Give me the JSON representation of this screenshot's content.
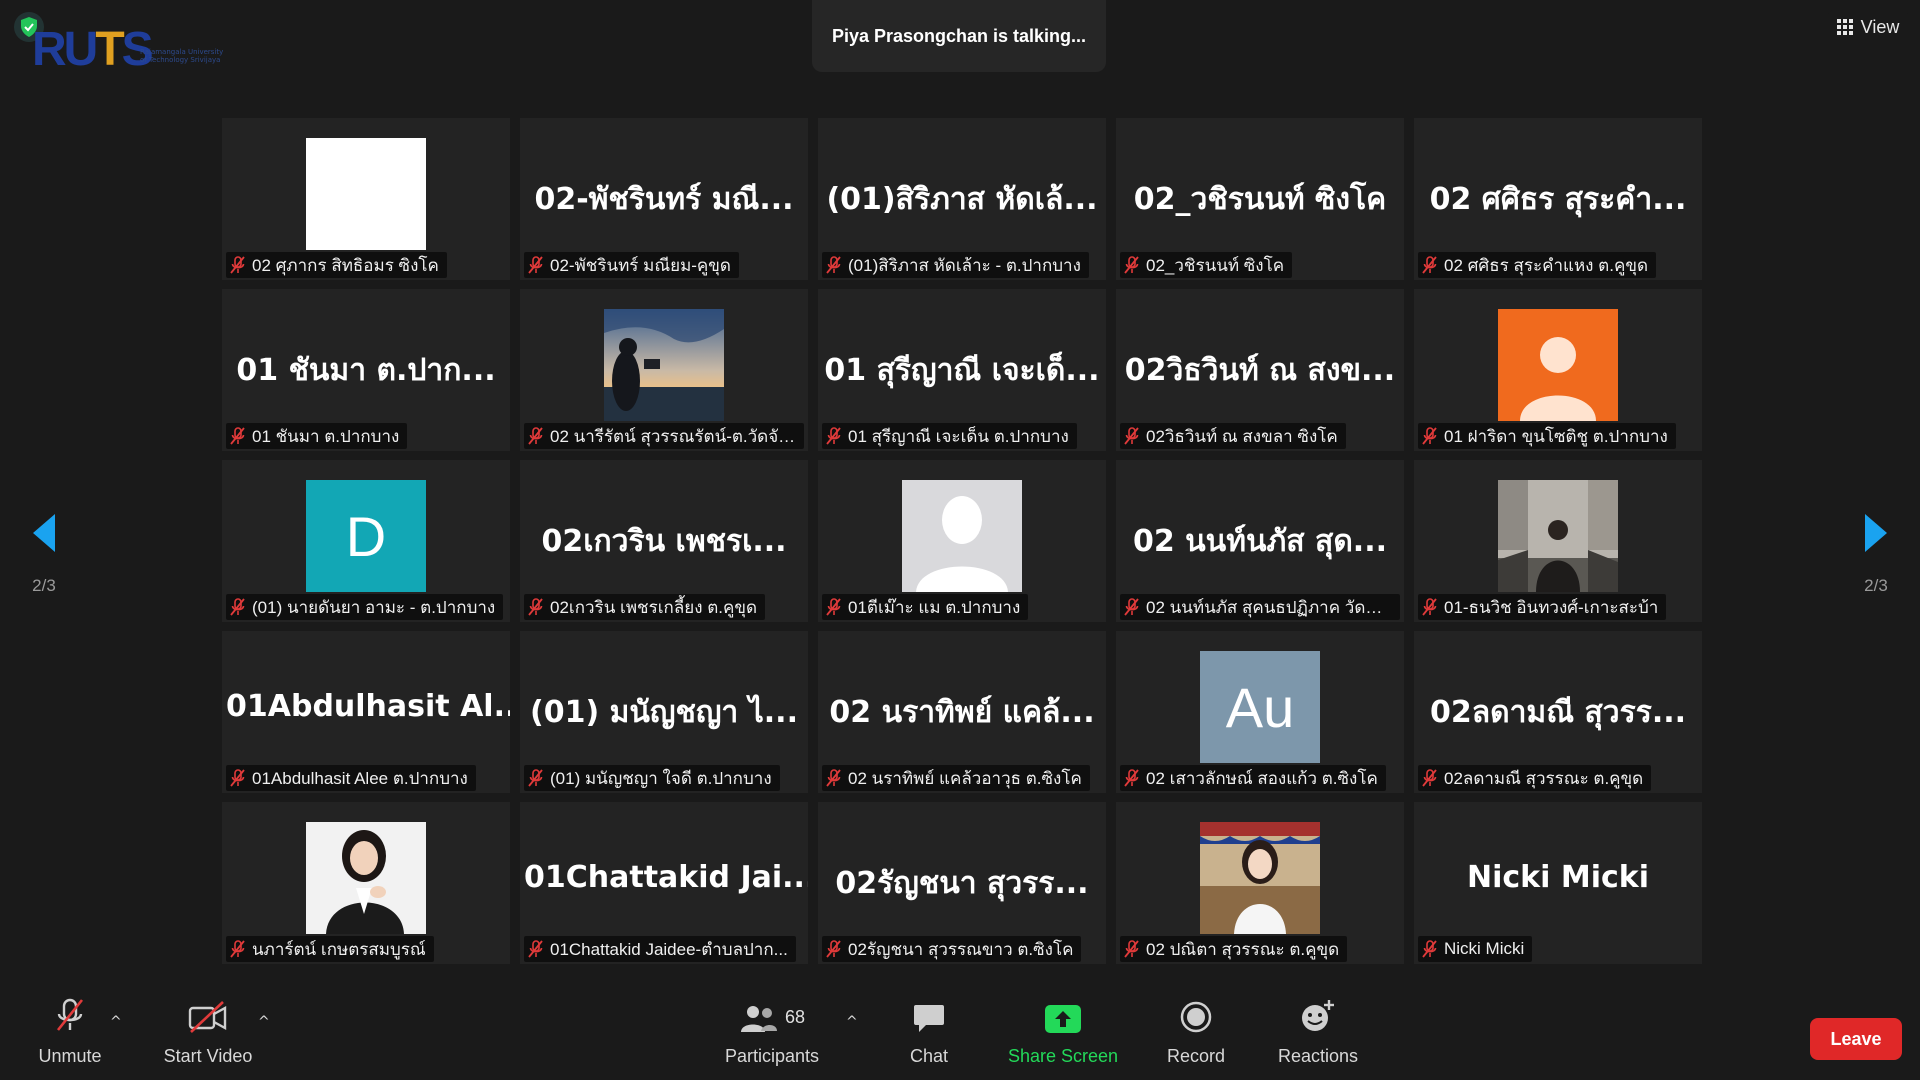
{
  "logo": {
    "text": "RUTS",
    "subtitle": "Rajamangala University of Technology Srivijaya"
  },
  "talking": "Piya Prasongchan is talking...",
  "view": {
    "label": "View"
  },
  "pager": {
    "left": "2/3",
    "right": "2/3"
  },
  "tiles": [
    {
      "big": "",
      "avatar": "white",
      "name": "02 ศุภากร สิทธิอมร ซิงโค"
    },
    {
      "big": "02-พัชรินทร์ มณี...",
      "avatar": "",
      "name": "02-พัชรินทร์ มณียม-คูขุด"
    },
    {
      "big": "(01)สิริภาส หัดเล้...",
      "avatar": "",
      "name": "(01)สิริภาส หัดเล้าะ - ต.ปากบาง"
    },
    {
      "big": "02_วชิรนนท์ ซิงโค",
      "avatar": "",
      "name": "02_วชิรนนท์ ซิงโค"
    },
    {
      "big": "02 ศศิธร สุระคำ...",
      "avatar": "",
      "name": "02 ศศิธร สุระคำแหง ต.คูขุด"
    },
    {
      "big": "01 ชันมา ต.ปาก...",
      "avatar": "",
      "name": "01 ชันมา ต.ปากบาง"
    },
    {
      "big": "",
      "avatar": "sunset",
      "name": "02 นารีรัตน์ สุวรรณรัตน์-ต.วัดจัน..."
    },
    {
      "big": "01 สุรีญาณี เจะเด็...",
      "avatar": "",
      "name": "01 สุรีญาณี เจะเด็น ต.ปากบาง"
    },
    {
      "big": "02วิธวินท์ ณ สงข...",
      "avatar": "",
      "name": "02วิธวินท์ ณ สงขลา ซิงโค"
    },
    {
      "big": "",
      "avatar": "orange",
      "name": "01 ฝาริดา ขุนโซติชู ต.ปากบาง"
    },
    {
      "big": "",
      "avatar": "letter-d",
      "letter": "D",
      "name": "(01) นายดันยา อามะ - ต.ปากบาง"
    },
    {
      "big": "02เกวริน เพชรเ...",
      "avatar": "",
      "name": "02เกวริน เพชรเกลี้ยง ต.คูขุด"
    },
    {
      "big": "",
      "avatar": "silhouette",
      "name": "01ตีเม๊าะ แม ต.ปากบาง"
    },
    {
      "big": "02 นนท์นภัส สุด...",
      "avatar": "",
      "name": "02 นนท์นภัส สุคนธปฏิภาค วัดจัน..."
    },
    {
      "big": "",
      "avatar": "man",
      "name": "01-ธนวิช อินทวงศ์-เกาะสะบ้า"
    },
    {
      "big": "01Abdulhasit Al...",
      "avatar": "",
      "name": "01Abdulhasit Alee ต.ปากบาง"
    },
    {
      "big": "(01) มนัญชญา ไ...",
      "avatar": "",
      "name": "(01) มนัญชญา ใจดี ต.ปากบาง"
    },
    {
      "big": "02 นราทิพย์ แคล้...",
      "avatar": "",
      "name": "02 นราทิพย์ แคล้วอาวุธ ต.ซิงโค"
    },
    {
      "big": "",
      "avatar": "letter-au",
      "letter": "Au",
      "name": "02 เสาวลักษณ์ สองแก้ว ต.ซิงโค"
    },
    {
      "big": "02ลดามณี สุวรร...",
      "avatar": "",
      "name": "02ลดามณี สุวรรณะ ต.คูขุด"
    },
    {
      "big": "",
      "avatar": "woman",
      "name": "นภาร์ตน์ เกษตรสมบูรณ์"
    },
    {
      "big": "01Chattakid Jai...",
      "avatar": "",
      "name": "01Chattakid Jaidee-ตำบลปาก..."
    },
    {
      "big": "02รัญชนา สุวรร...",
      "avatar": "",
      "name": "02รัญชนา สุวรรณขาว ต.ซิงโค"
    },
    {
      "big": "",
      "avatar": "girl",
      "name": "02 ปณิตา สุวรรณะ ต.คูขุด"
    },
    {
      "big": "Nicki Micki",
      "avatar": "",
      "name": "Nicki Micki"
    }
  ],
  "toolbar": {
    "unmute": "Unmute",
    "start_video": "Start Video",
    "participants": "Participants",
    "participants_count": "68",
    "chat": "Chat",
    "share": "Share Screen",
    "record": "Record",
    "reactions": "Reactions",
    "leave": "Leave"
  },
  "colors": {
    "share_green": "#23d959",
    "leave_red": "#e02828",
    "arrow_blue": "#1aa3f0",
    "mic_red": "#e03a3a"
  }
}
